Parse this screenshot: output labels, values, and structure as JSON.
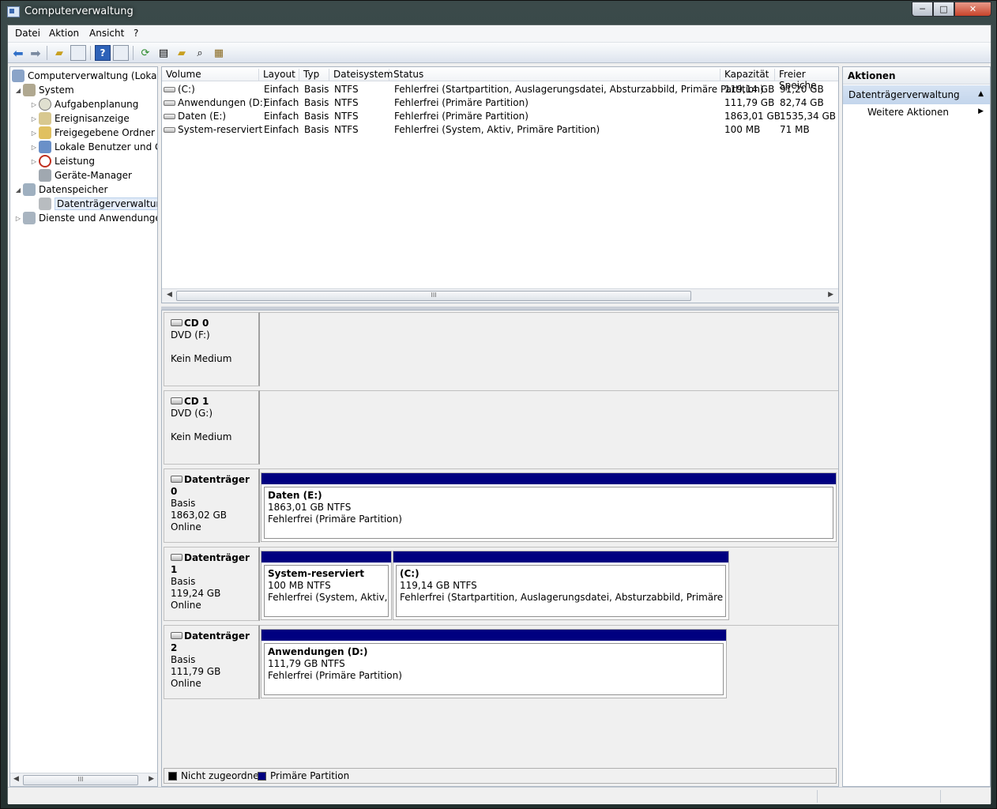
{
  "window": {
    "title": "Computerverwaltung",
    "buttons": {
      "minimize": "─",
      "maximize": "□",
      "close": "✕"
    }
  },
  "menu": [
    {
      "id": "datei",
      "label": "Datei"
    },
    {
      "id": "aktion",
      "label": "Aktion"
    },
    {
      "id": "ansicht",
      "label": "Ansicht"
    },
    {
      "id": "hilfe",
      "label": "?"
    }
  ],
  "toolbar": {
    "icons": [
      "back-arrow-icon",
      "forward-arrow-icon",
      "up-folder-icon",
      "show-hide-tree-icon",
      "help-icon",
      "show-hide-action-pane-icon",
      "refresh-icon",
      "properties-icon",
      "open-icon",
      "search-icon",
      "settings-icon"
    ]
  },
  "tree": {
    "nodes": [
      {
        "label": "Computerverwaltung (Lokal)",
        "icon": "computer-management-icon",
        "expander": ""
      },
      {
        "label": "System",
        "icon": "system-tools-icon",
        "expander": "◢"
      },
      {
        "label": "Aufgabenplanung",
        "icon": "clock-icon",
        "expander": "▷"
      },
      {
        "label": "Ereignisanzeige",
        "icon": "event-viewer-icon",
        "expander": "▷"
      },
      {
        "label": "Freigegebene Ordner",
        "icon": "shared-folder-icon",
        "expander": "▷"
      },
      {
        "label": "Lokale Benutzer und Gru",
        "icon": "users-icon",
        "expander": "▷"
      },
      {
        "label": "Leistung",
        "icon": "performance-icon",
        "expander": "▷"
      },
      {
        "label": "Geräte-Manager",
        "icon": "device-manager-icon",
        "expander": ""
      },
      {
        "label": "Datenspeicher",
        "icon": "storage-icon",
        "expander": "◢"
      },
      {
        "label": "Datenträgerverwaltung",
        "icon": "disk-management-icon",
        "expander": ""
      },
      {
        "label": "Dienste und Anwendungen",
        "icon": "services-icon",
        "expander": "▷"
      }
    ],
    "scroll_thumb": "III"
  },
  "volumes": {
    "columns": [
      "Volume",
      "Layout",
      "Typ",
      "Dateisystem",
      "Status",
      "Kapazität",
      "Freier Speiche"
    ],
    "rows": [
      {
        "volume": "(C:)",
        "layout": "Einfach",
        "typ": "Basis",
        "fs": "NTFS",
        "status": "Fehlerfrei (Startpartition, Auslagerungsdatei, Absturzabbild, Primäre Partition)",
        "kap": "119,14 GB",
        "frei": "91,20 GB"
      },
      {
        "volume": "Anwendungen (D:)",
        "layout": "Einfach",
        "typ": "Basis",
        "fs": "NTFS",
        "status": "Fehlerfrei (Primäre Partition)",
        "kap": "111,79 GB",
        "frei": "82,74 GB"
      },
      {
        "volume": "Daten (E:)",
        "layout": "Einfach",
        "typ": "Basis",
        "fs": "NTFS",
        "status": "Fehlerfrei (Primäre Partition)",
        "kap": "1863,01 GB",
        "frei": "1535,34 GB"
      },
      {
        "volume": "System-reserviert",
        "layout": "Einfach",
        "typ": "Basis",
        "fs": "NTFS",
        "status": "Fehlerfrei (System, Aktiv, Primäre Partition)",
        "kap": "100 MB",
        "frei": "71 MB"
      }
    ],
    "scroll_thumb": "III"
  },
  "disks": [
    {
      "name": "CD 0",
      "line1": "DVD (F:)",
      "line2": "",
      "line3": "Kein Medium",
      "partitions": []
    },
    {
      "name": "CD 1",
      "line1": "DVD (G:)",
      "line2": "",
      "line3": "Kein Medium",
      "partitions": []
    },
    {
      "name": "Datenträger 0",
      "line1": "Basis",
      "line2": "1863,02 GB",
      "line3": "Online",
      "partitions": [
        {
          "name": "Daten  (E:)",
          "size": "1863,01 GB NTFS",
          "status": "Fehlerfrei (Primäre Partition)"
        }
      ]
    },
    {
      "name": "Datenträger 1",
      "line1": "Basis",
      "line2": "119,24 GB",
      "line3": "Online",
      "partitions": [
        {
          "name": "System-reserviert",
          "size": "100 MB NTFS",
          "status": "Fehlerfrei (System, Aktiv, Prir"
        },
        {
          "name": " (C:)",
          "size": "119,14 GB NTFS",
          "status": "Fehlerfrei (Startpartition, Auslagerungsdatei, Absturzabbild, Primäre Partition)"
        }
      ]
    },
    {
      "name": "Datenträger 2",
      "line1": "Basis",
      "line2": "111,79 GB",
      "line3": "Online",
      "partitions": [
        {
          "name": "Anwendungen  (D:)",
          "size": "111,79 GB NTFS",
          "status": "Fehlerfrei (Primäre Partition)"
        }
      ]
    }
  ],
  "legend": [
    {
      "label": "Nicht zugeordnet",
      "color": "#000000"
    },
    {
      "label": "Primäre Partition",
      "color": "#000080"
    }
  ],
  "actions": {
    "header": "Aktionen",
    "section": "Datenträgerverwaltung",
    "section_arrow": "▲",
    "item": "Weitere Aktionen",
    "item_arrow": "▶"
  }
}
